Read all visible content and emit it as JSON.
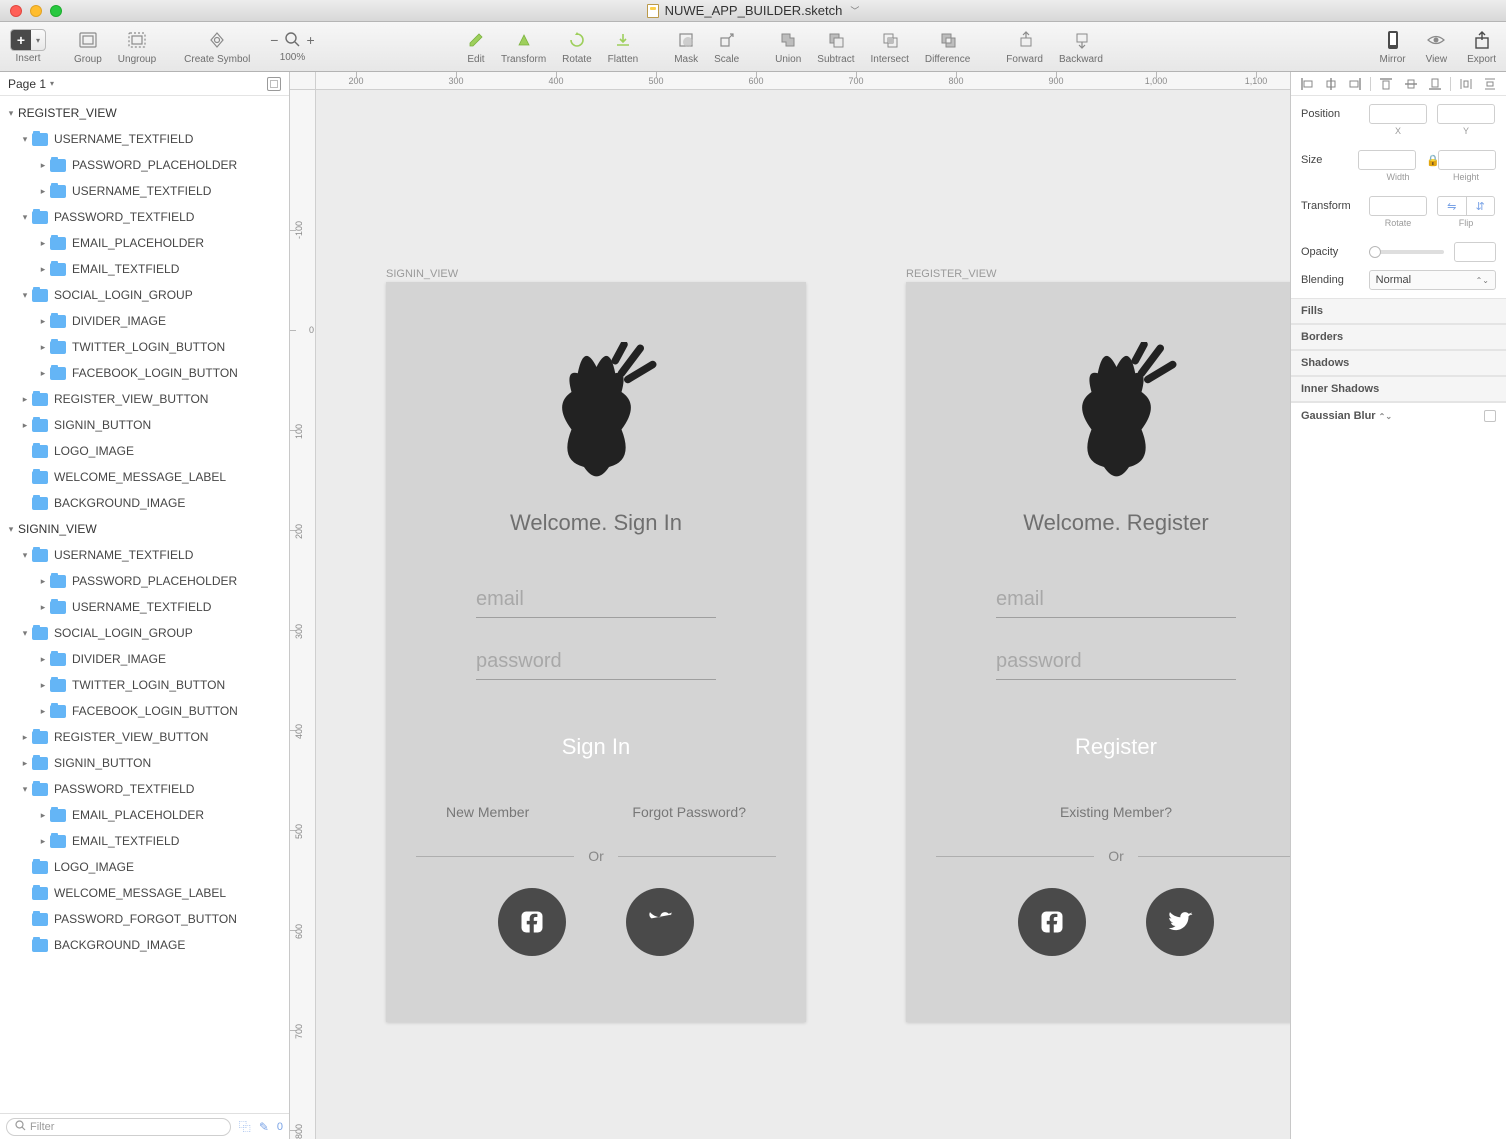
{
  "window": {
    "title": "NUWE_APP_BUILDER.sketch"
  },
  "toolbar": {
    "insert": "Insert",
    "group": "Group",
    "ungroup": "Ungroup",
    "create_symbol": "Create Symbol",
    "zoom": "100%",
    "edit": "Edit",
    "transform": "Transform",
    "rotate": "Rotate",
    "flatten": "Flatten",
    "mask": "Mask",
    "scale": "Scale",
    "union": "Union",
    "subtract": "Subtract",
    "intersect": "Intersect",
    "difference": "Difference",
    "forward": "Forward",
    "backward": "Backward",
    "mirror": "Mirror",
    "view": "View",
    "export": "Export"
  },
  "page": {
    "label": "Page 1"
  },
  "layers": {
    "artboard1": "REGISTER_VIEW",
    "a1": {
      "g1": "USERNAME_TEXTFIELD",
      "g1a": "PASSWORD_PLACEHOLDER",
      "g1b": "USERNAME_TEXTFIELD",
      "g2": "PASSWORD_TEXTFIELD",
      "g2a": "EMAIL_PLACEHOLDER",
      "g2b": "EMAIL_TEXTFIELD",
      "g3": "SOCIAL_LOGIN_GROUP",
      "g3a": "DIVIDER_IMAGE",
      "g3b": "TWITTER_LOGIN_BUTTON",
      "g3c": "FACEBOOK_LOGIN_BUTTON",
      "l4": "REGISTER_VIEW_BUTTON",
      "l5": "SIGNIN_BUTTON",
      "l6": "LOGO_IMAGE",
      "l7": "WELCOME_MESSAGE_LABEL",
      "l8": "BACKGROUND_IMAGE"
    },
    "artboard2": "SIGNIN_VIEW",
    "a2": {
      "g1": "USERNAME_TEXTFIELD",
      "g1a": "PASSWORD_PLACEHOLDER",
      "g1b": "USERNAME_TEXTFIELD",
      "g2": "SOCIAL_LOGIN_GROUP",
      "g2a": "DIVIDER_IMAGE",
      "g2b": "TWITTER_LOGIN_BUTTON",
      "g2c": "FACEBOOK_LOGIN_BUTTON",
      "l3": "REGISTER_VIEW_BUTTON",
      "l4": "SIGNIN_BUTTON",
      "g5": "PASSWORD_TEXTFIELD",
      "g5a": "EMAIL_PLACEHOLDER",
      "g5b": "EMAIL_TEXTFIELD",
      "l6": "LOGO_IMAGE",
      "l7": "WELCOME_MESSAGE_LABEL",
      "l8": "PASSWORD_FORGOT_BUTTON",
      "l9": "BACKGROUND_IMAGE"
    }
  },
  "filter": {
    "placeholder": "Filter",
    "count": "0"
  },
  "ruler": {
    "h": [
      "200",
      "300",
      "400",
      "500",
      "600",
      "700",
      "800",
      "900",
      "1,000",
      "1,100"
    ],
    "v": [
      "-100",
      "0",
      "100",
      "200",
      "300",
      "400",
      "500",
      "600",
      "700",
      "800"
    ]
  },
  "canvas": {
    "signin_label": "SIGNIN_VIEW",
    "register_label": "REGISTER_VIEW",
    "signin": {
      "title": "Welcome. Sign In",
      "email_ph": "email",
      "password_ph": "password",
      "primary": "Sign In",
      "new_member": "New Member",
      "forgot": "Forgot Password?",
      "or": "Or"
    },
    "register": {
      "title": "Welcome. Register",
      "email_ph": "email",
      "password_ph": "password",
      "primary": "Register",
      "existing": "Existing Member?",
      "or": "Or"
    }
  },
  "inspector": {
    "position": "Position",
    "x": "X",
    "y": "Y",
    "size": "Size",
    "width": "Width",
    "height": "Height",
    "transform": "Transform",
    "rotate": "Rotate",
    "flip": "Flip",
    "opacity": "Opacity",
    "blending": "Blending",
    "blending_val": "Normal",
    "fills": "Fills",
    "borders": "Borders",
    "shadows": "Shadows",
    "inner_shadows": "Inner Shadows",
    "gaussian": "Gaussian Blur"
  }
}
